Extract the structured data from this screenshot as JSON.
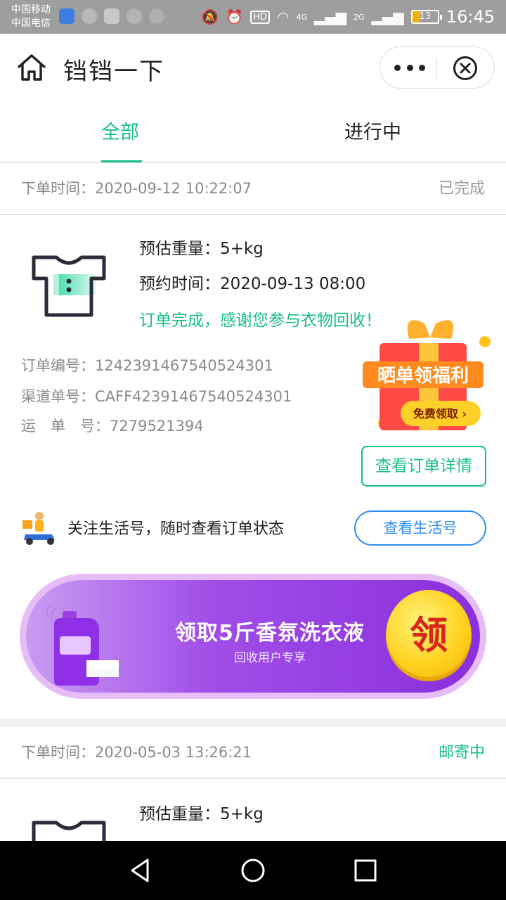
{
  "status_bar": {
    "carrier_line1": "中国移动",
    "carrier_line2": "中国电信",
    "signal_4g": "4G",
    "signal_2g": "2G",
    "hd": "HD",
    "battery": "13",
    "battery_fraction": 0.13,
    "time": "16:45"
  },
  "title_bar": {
    "title": "铛铛一下",
    "icons": [
      "home-icon",
      "more-icon",
      "close-icon"
    ]
  },
  "tabs": [
    {
      "label": "全部",
      "active": true
    },
    {
      "label": "进行中",
      "active": false
    }
  ],
  "orders": [
    {
      "time_label": "下单时间：",
      "time": "2020-09-12 10:22:07",
      "status": "已完成",
      "status_color": "#9a9a9a",
      "weight_label": "预估重量：",
      "weight": "5+kg",
      "appoint_label": "预约时间：",
      "appoint": "2020-09-13 08:00",
      "done_message": "订单完成，感谢您参与衣物回收！",
      "order_no_label": "订单编号：",
      "order_no": "1242391467540524301",
      "channel_no_label": "渠道单号：",
      "channel_no": "CAFF42391467540524301",
      "waybill_label": "运　单　号：",
      "waybill": "7279521394",
      "detail_button": "查看订单详情"
    },
    {
      "time_label": "下单时间：",
      "time": "2020-05-03 13:26:21",
      "status": "邮寄中",
      "status_color": "#19bd8c",
      "weight_label": "预估重量：",
      "weight": "5+kg"
    }
  ],
  "gift_badge": {
    "title": "晒单领福利",
    "button": "免费领取 ›"
  },
  "follow": {
    "text": "关注生活号，随时查看订单状态",
    "button": "查看生活号"
  },
  "banner": {
    "title": "领取5斤香氛洗衣液",
    "subtitle": "回收用户专享",
    "coin": "领"
  },
  "colors": {
    "accent": "#19bd8c",
    "link_blue": "#2f8cf0",
    "banner_purple": "#8a2fdd"
  }
}
